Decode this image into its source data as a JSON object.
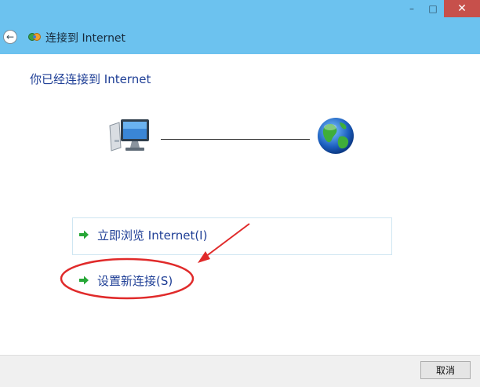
{
  "window": {
    "title": "连接到 Internet",
    "controls": {
      "minimize": "–",
      "maximize": "□",
      "close": "✕"
    }
  },
  "nav": {
    "back_icon": "back-arrow-icon"
  },
  "main": {
    "heading": "你已经连接到 Internet",
    "illustration": {
      "left_icon": "computer-icon",
      "right_icon": "globe-icon"
    }
  },
  "options": [
    {
      "label": "立即浏览 Internet(I)",
      "icon": "green-arrow-icon"
    },
    {
      "label": "设置新连接(S)",
      "icon": "green-arrow-icon"
    }
  ],
  "footer": {
    "cancel_label": "取消"
  },
  "colors": {
    "titlebar": "#6cc2ef",
    "close_button": "#c7504b",
    "link_text": "#1f3f96",
    "arrow_green": "#27a737",
    "annotation_red": "#e02a2a"
  }
}
